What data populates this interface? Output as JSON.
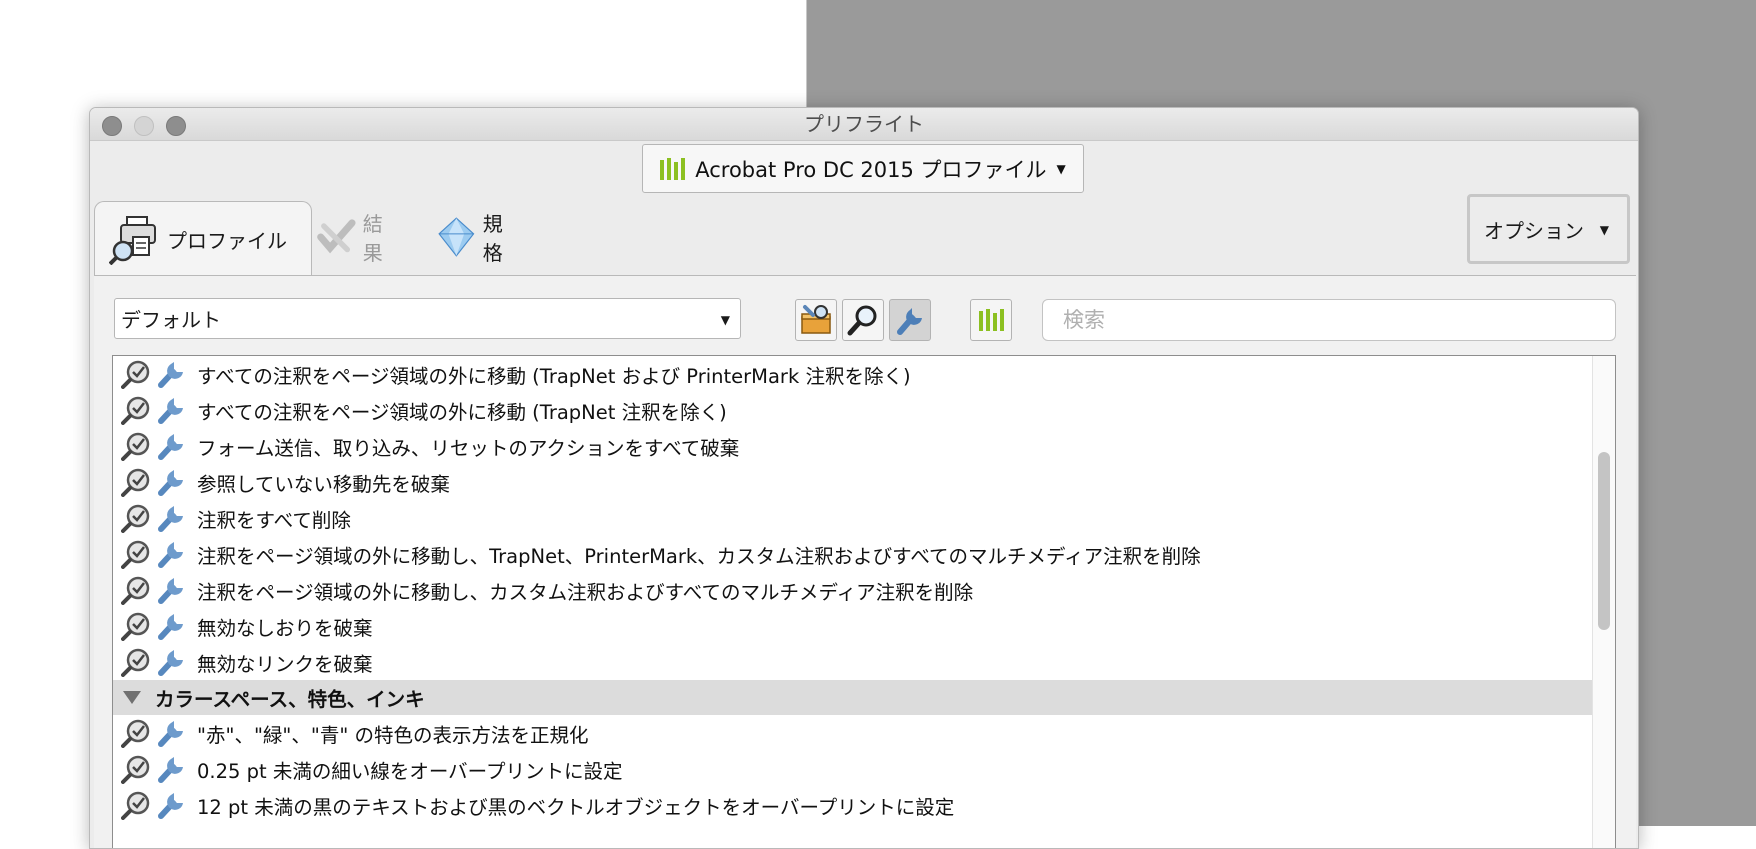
{
  "window": {
    "title": "プリフライト"
  },
  "profile_dropdown": {
    "label": "Acrobat Pro DC 2015 プロファイル"
  },
  "tabs": [
    {
      "label": "プロファイル",
      "icon": "printer-magnifier-icon",
      "active": true
    },
    {
      "label": "結果",
      "icon": "results-checkmark-icon",
      "active": false,
      "disabled": true
    },
    {
      "label": "規格",
      "icon": "standards-diamond-icon",
      "active": false
    }
  ],
  "options": {
    "label": "オプション"
  },
  "toolbar": {
    "category_select": "デフォルト",
    "search_placeholder": "検索"
  },
  "fixups": [
    "すべての注釈をページ領域の外に移動 (TrapNet および PrinterMark 注釈を除く)",
    "すべての注釈をページ領域の外に移動 (TrapNet 注釈を除く)",
    "フォーム送信、取り込み、リセットのアクションをすべて破棄",
    "参照していない移動先を破棄",
    "注釈をすべて削除",
    "注釈をページ領域の外に移動し、TrapNet、PrinterMark、カスタム注釈およびすべてのマルチメディア注釈を削除",
    "注釈をページ領域の外に移動し、カスタム注釈およびすべてのマルチメディア注釈を削除",
    "無効なしおりを破棄",
    "無効なリンクを破棄"
  ],
  "section": {
    "label": "カラースペース、特色、インキ"
  },
  "section_fixups": [
    "\"赤\"、\"緑\"、\"青\" の特色の表示方法を正規化",
    "0.25 pt 未満の細い線をオーバープリントに設定",
    "12 pt 未満の黒のテキストおよび黒のベクトルオブジェクトをオーバープリントに設定"
  ]
}
